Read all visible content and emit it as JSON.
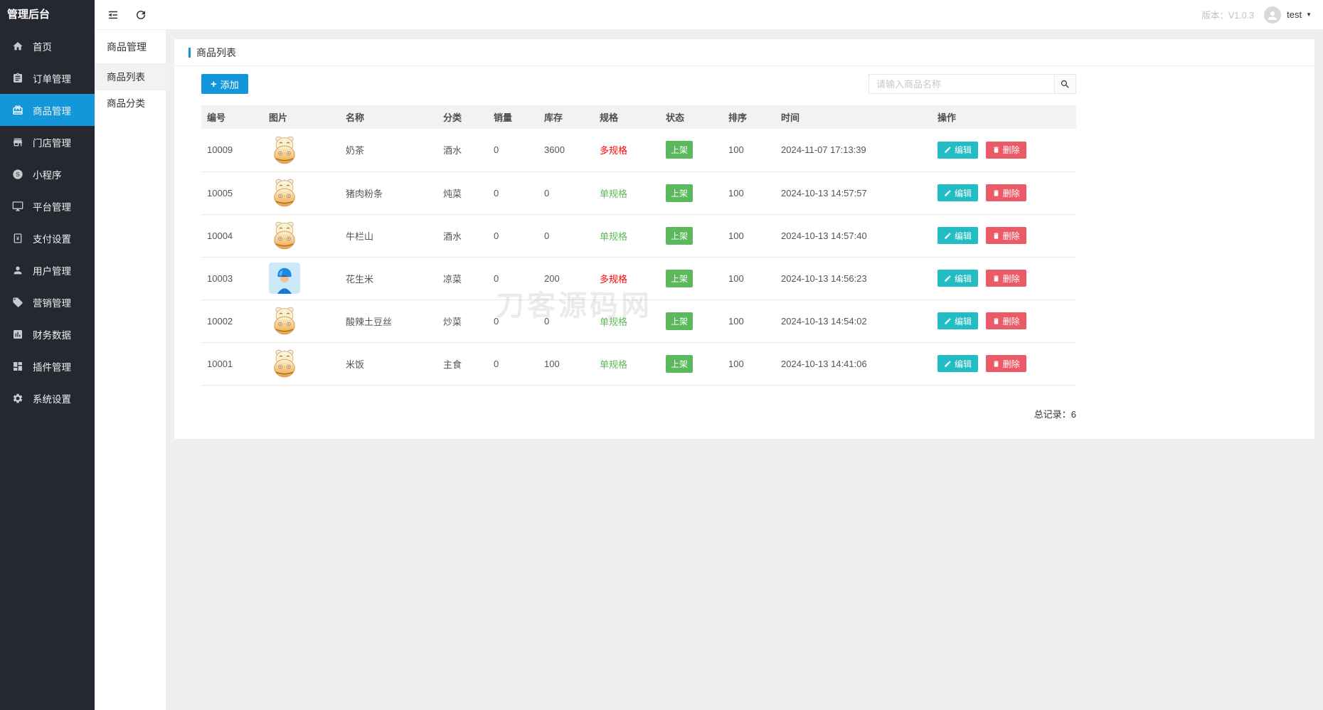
{
  "colors": {
    "accent": "#1496db",
    "sidebar-bg": "#252830",
    "edit-color": "#22bcc5",
    "delete-color": "#ea5a67",
    "badge-green": "#5cb85c",
    "spec-red": "#ff0000",
    "spec-green": "#5cb85c"
  },
  "sidebar": {
    "title": "管理后台",
    "items": [
      {
        "label": "首页",
        "icon": "home-icon"
      },
      {
        "label": "订单管理",
        "icon": "order-icon"
      },
      {
        "label": "商品管理",
        "icon": "product-icon",
        "active": true
      },
      {
        "label": "门店管理",
        "icon": "store-icon"
      },
      {
        "label": "小程序",
        "icon": "miniprogram-icon"
      },
      {
        "label": "平台管理",
        "icon": "platform-icon"
      },
      {
        "label": "支付设置",
        "icon": "payment-icon"
      },
      {
        "label": "用户管理",
        "icon": "user-icon"
      },
      {
        "label": "营销管理",
        "icon": "marketing-icon"
      },
      {
        "label": "财务数据",
        "icon": "finance-icon"
      },
      {
        "label": "插件管理",
        "icon": "plugin-icon"
      },
      {
        "label": "系统设置",
        "icon": "settings-icon"
      }
    ]
  },
  "topbar": {
    "version": "版本：V1.0.3",
    "username": "test",
    "caret": "▼"
  },
  "submenu": {
    "title": "商品管理",
    "items": [
      {
        "label": "商品列表",
        "active": true
      },
      {
        "label": "商品分类",
        "active": false
      }
    ]
  },
  "page": {
    "title": "商品列表"
  },
  "toolbar": {
    "add_label": "添加",
    "plus": "+"
  },
  "search": {
    "placeholder": "请输入商品名称"
  },
  "watermark": {
    "text": "刀客源码网"
  },
  "table": {
    "columns": [
      "编号",
      "图片",
      "名称",
      "分类",
      "销量",
      "库存",
      "规格",
      "状态",
      "排序",
      "时间",
      "操作"
    ],
    "actions": {
      "edit": "编辑",
      "delete": "删除"
    },
    "rows": [
      {
        "id": "10009",
        "name": "奶茶",
        "category": "酒水",
        "sales": "0",
        "stock": "3600",
        "spec": "多规格",
        "status": "上架",
        "sort": "100",
        "time": "2024-11-07 17:13:39",
        "image": "hippo"
      },
      {
        "id": "10005",
        "name": "猪肉粉条",
        "category": "炖菜",
        "sales": "0",
        "stock": "0",
        "spec": "单规格",
        "status": "上架",
        "sort": "100",
        "time": "2024-10-13 14:57:57",
        "image": "hippo"
      },
      {
        "id": "10004",
        "name": "牛栏山",
        "category": "酒水",
        "sales": "0",
        "stock": "0",
        "spec": "单规格",
        "status": "上架",
        "sort": "100",
        "time": "2024-10-13 14:57:40",
        "image": "hippo"
      },
      {
        "id": "10003",
        "name": "花生米",
        "category": "凉菜",
        "sales": "0",
        "stock": "200",
        "spec": "多规格",
        "status": "上架",
        "sort": "100",
        "time": "2024-10-13 14:56:23",
        "image": "rider"
      },
      {
        "id": "10002",
        "name": "酸辣土豆丝",
        "category": "炒菜",
        "sales": "0",
        "stock": "0",
        "spec": "单规格",
        "status": "上架",
        "sort": "100",
        "time": "2024-10-13 14:54:02",
        "image": "hippo"
      },
      {
        "id": "10001",
        "name": "米饭",
        "category": "主食",
        "sales": "0",
        "stock": "100",
        "spec": "单规格",
        "status": "上架",
        "sort": "100",
        "time": "2024-10-13 14:41:06",
        "image": "hippo"
      }
    ]
  },
  "footer": {
    "total_label": "总记录：",
    "total_value": "6"
  }
}
